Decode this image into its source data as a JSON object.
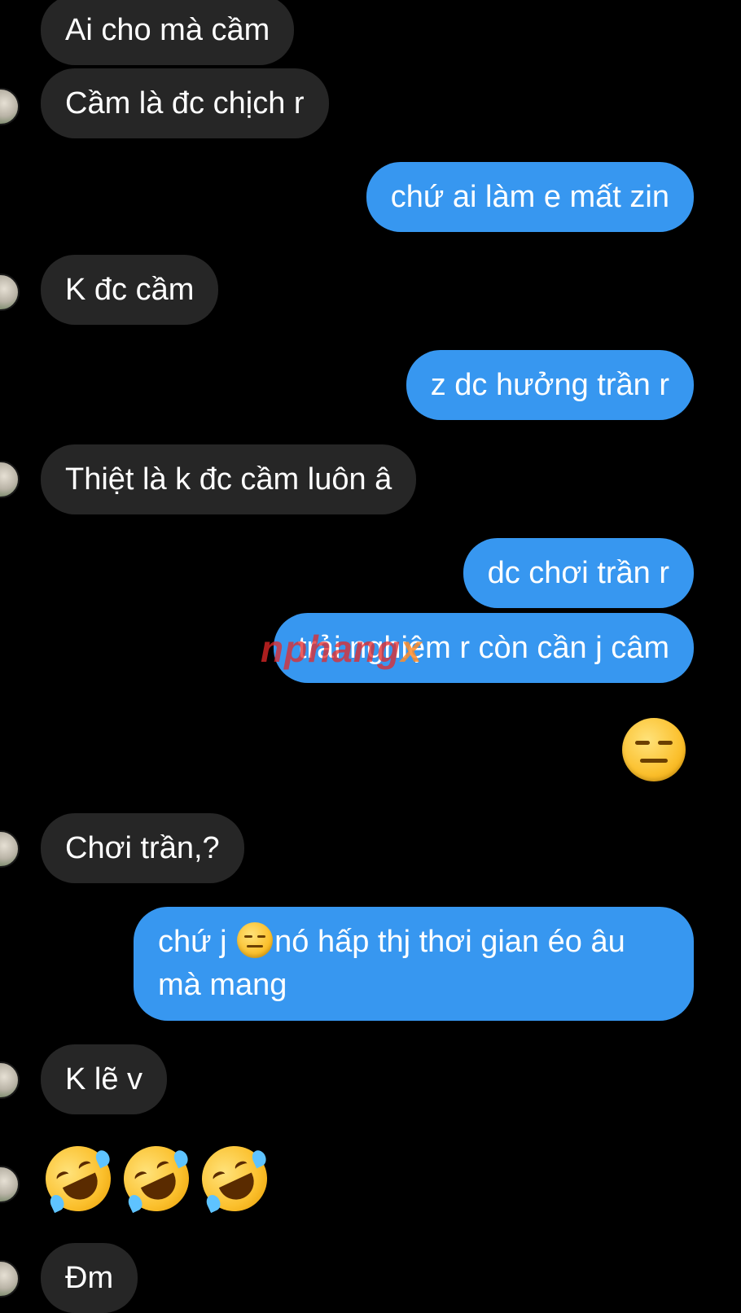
{
  "messages": {
    "m1": "Ai cho mà cầm",
    "m2": "Cầm là đc chịch r",
    "m3": "chứ ai làm e mất zin",
    "m4": "K đc cầm",
    "m5": "z dc hưởng trần r",
    "m6": "Thiệt là k đc cầm luôn â",
    "m7": "dc chơi trần r",
    "m8": "trải nghiệm r còn cần j câm",
    "m9_emoji": "expressionless-face-emoji",
    "m10": "Chơi trần,?",
    "m11_part1": "chứ j",
    "m11_emoji": "expressionless-face-emoji",
    "m11_part2": "nó hấp thj thơi gian éo âu mà mang",
    "m12": "K lẽ v",
    "m13_emoji": [
      "rofl-emoji",
      "rofl-emoji",
      "rofl-emoji"
    ],
    "m14": "Đm"
  },
  "watermark": {
    "text_main": "nphang",
    "text_x": "x"
  },
  "colors": {
    "background": "#000000",
    "incoming_bubble": "#262626",
    "outgoing_bubble": "#3797f0",
    "text": "#ffffff"
  }
}
